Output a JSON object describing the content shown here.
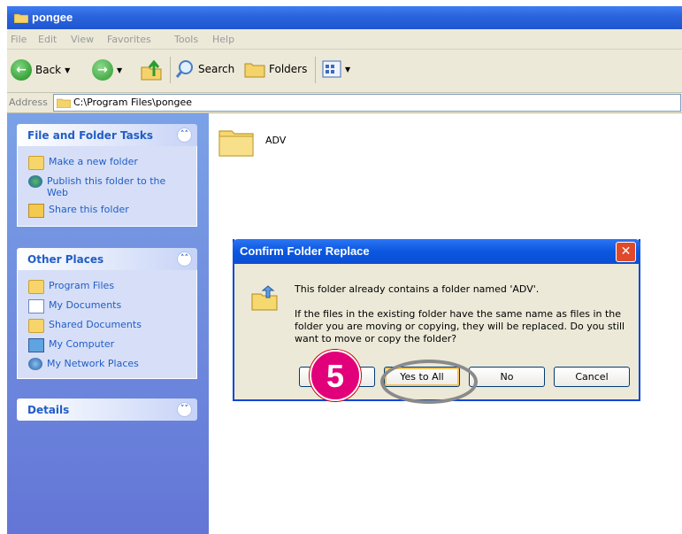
{
  "window": {
    "title": "pongee"
  },
  "menu": [
    "File",
    "Edit",
    "View",
    "Favorites",
    "Tools",
    "Help"
  ],
  "toolbar": {
    "back_label": "Back",
    "search_label": "Search",
    "folders_label": "Folders"
  },
  "address": {
    "label": "Address",
    "path": "C:\\Program Files\\pongee"
  },
  "left_pane": {
    "file_tasks": {
      "title": "File and Folder Tasks",
      "items": [
        "Make a new folder",
        "Publish this folder to the Web",
        "Share this folder"
      ]
    },
    "other_places": {
      "title": "Other Places",
      "items": [
        "Program Files",
        "My Documents",
        "Shared Documents",
        "My Computer",
        "My Network Places"
      ]
    },
    "details": {
      "title": "Details"
    }
  },
  "content": {
    "folders": [
      "ADV"
    ]
  },
  "dialog": {
    "title": "Confirm Folder Replace",
    "line1": "This folder already contains a folder named 'ADV'.",
    "line2": "If the files in the existing folder have the same name as files in the",
    "line3": "folder you are moving or copying, they will be replaced.  Do you still",
    "line4": "want to move or copy the folder?",
    "buttons": {
      "yes_all": "Yes to All",
      "no": "No",
      "cancel": "Cancel"
    }
  },
  "overlay": {
    "step_number": "5"
  }
}
